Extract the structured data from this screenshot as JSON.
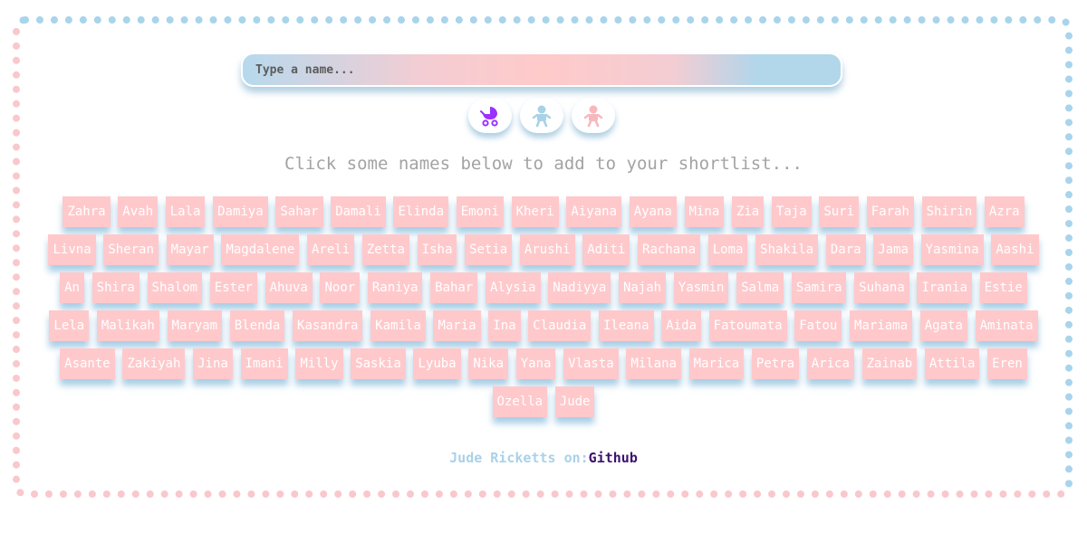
{
  "search": {
    "placeholder": "Type a name..."
  },
  "filters": [
    {
      "icon": "baby-stroller-icon",
      "color": "#9b30ff"
    },
    {
      "icon": "baby-boy-icon",
      "color": "#a9d2e8"
    },
    {
      "icon": "baby-girl-icon",
      "color": "#f7b8bd"
    }
  ],
  "prompt": "Click some names below to add to your shortlist...",
  "names": [
    "Zahra",
    "Avah",
    "Lala",
    "Damiya",
    "Sahar",
    "Damali",
    "Elinda",
    "Emoni",
    "Kheri",
    "Aiyana",
    "Ayana",
    "Mina",
    "Zia",
    "Taja",
    "Suri",
    "Farah",
    "Shirin",
    "Azra",
    "Livna",
    "Sheran",
    "Mayar",
    "Magdalene",
    "Areli",
    "Zetta",
    "Isha",
    "Setia",
    "Arushi",
    "Aditi",
    "Rachana",
    "Loma",
    "Shakila",
    "Dara",
    "Jama",
    "Yasmina",
    "Aashi",
    "An",
    "Shira",
    "Shalom",
    "Ester",
    "Ahuva",
    "Noor",
    "Raniya",
    "Bahar",
    "Alysia",
    "Nadiyya",
    "Najah",
    "Yasmin",
    "Salma",
    "Samira",
    "Suhana",
    "Irania",
    "Estie",
    "Lela",
    "Malikah",
    "Maryam",
    "Blenda",
    "Kasandra",
    "Kamila",
    "Maria",
    "Ina",
    "Claudia",
    "Ileana",
    "Aida",
    "Fatoumata",
    "Fatou",
    "Mariama",
    "Agata",
    "Aminata",
    "Asante",
    "Zakiyah",
    "Jina",
    "Imani",
    "Milly",
    "Saskia",
    "Lyuba",
    "Nika",
    "Yana",
    "Vlasta",
    "Milana",
    "Marica",
    "Petra",
    "Arica",
    "Zainab",
    "Attila",
    "Eren",
    "Ozella",
    "Jude"
  ],
  "footer": {
    "credit": "Jude Ricketts on:",
    "link": "Github"
  },
  "colors": {
    "pink": "#ffc9cc",
    "blue": "#a9d2e8",
    "link": "#3c1270"
  }
}
